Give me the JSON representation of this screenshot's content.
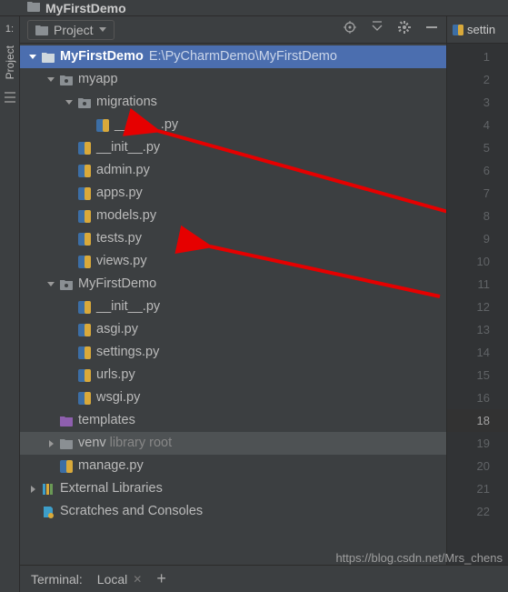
{
  "window": {
    "title": "MyFirstDemo"
  },
  "leftRail": {
    "number": "1:",
    "label": "Project"
  },
  "panel": {
    "title": "Project",
    "icons": {
      "target": "target-icon",
      "collapse": "collapse-icon",
      "settings": "gear-icon",
      "hide": "minimize-icon"
    }
  },
  "tree": {
    "root": {
      "name": "MyFirstDemo",
      "path": "E:\\PyCharmDemo\\MyFirstDemo"
    },
    "myapp": {
      "name": "myapp"
    },
    "migrations": {
      "name": "migrations"
    },
    "mig_init": {
      "name": "__init__.py"
    },
    "app_init": {
      "name": "__init__.py"
    },
    "admin": {
      "name": "admin.py"
    },
    "apps": {
      "name": "apps.py"
    },
    "models": {
      "name": "models.py"
    },
    "tests": {
      "name": "tests.py"
    },
    "views": {
      "name": "views.py"
    },
    "mfd": {
      "name": "MyFirstDemo"
    },
    "mfd_init": {
      "name": "__init__.py"
    },
    "asgi": {
      "name": "asgi.py"
    },
    "settings": {
      "name": "settings.py"
    },
    "urls": {
      "name": "urls.py"
    },
    "wsgi": {
      "name": "wsgi.py"
    },
    "templates": {
      "name": "templates"
    },
    "venv": {
      "name": "venv",
      "suffix": "library root"
    },
    "manage": {
      "name": "manage.py"
    },
    "ext": {
      "name": "External Libraries"
    },
    "scratches": {
      "name": "Scratches and Consoles"
    }
  },
  "editor": {
    "tab": "settin",
    "lines": [
      "1",
      "2",
      "3",
      "4",
      "5",
      "6",
      "7",
      "8",
      "9",
      "10",
      "11",
      "12",
      "13",
      "14",
      "15",
      "16",
      "18",
      "19",
      "20",
      "21",
      "22"
    ],
    "currentLine": "18"
  },
  "terminal": {
    "label": "Terminal:",
    "tab": "Local"
  },
  "watermark": "https://blog.csdn.net/Mrs_chens"
}
